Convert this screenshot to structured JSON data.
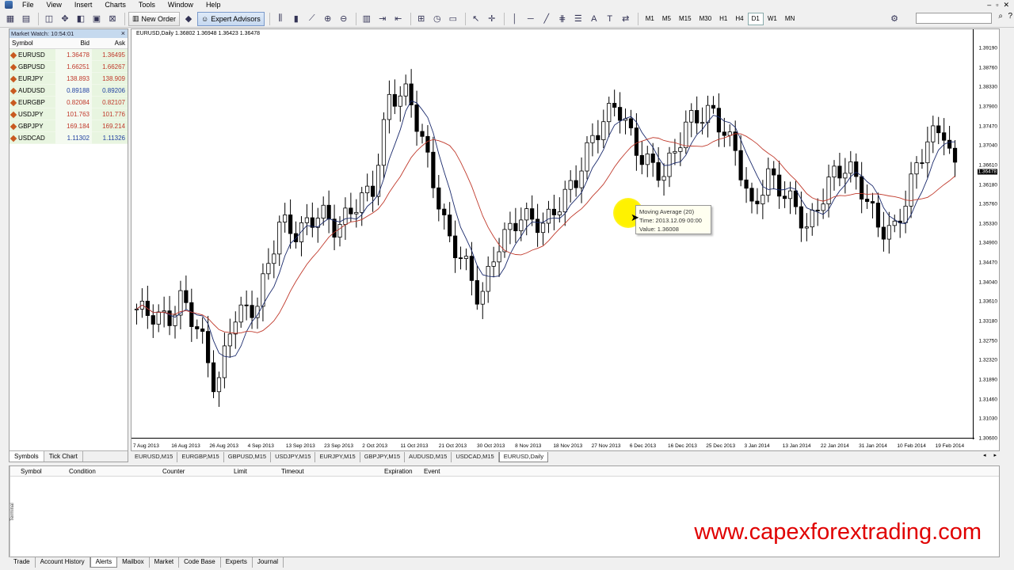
{
  "menu": [
    "File",
    "View",
    "Insert",
    "Charts",
    "Tools",
    "Window",
    "Help"
  ],
  "toolbar": {
    "new_order": "New Order",
    "expert_advisors": "Expert Advisors",
    "timeframes": [
      "M1",
      "M5",
      "M15",
      "M30",
      "H1",
      "H4",
      "D1",
      "W1",
      "MN"
    ],
    "active_timeframe": "D1"
  },
  "market_watch": {
    "title": "Market Watch: 10:54:01",
    "headers": {
      "symbol": "Symbol",
      "bid": "Bid",
      "ask": "Ask"
    },
    "rows": [
      {
        "symbol": "EURUSD",
        "bid": "1.36478",
        "ask": "1.36495",
        "color": "#c0392b"
      },
      {
        "symbol": "GBPUSD",
        "bid": "1.66251",
        "ask": "1.66267",
        "color": "#c0392b"
      },
      {
        "symbol": "EURJPY",
        "bid": "138.893",
        "ask": "138.909",
        "color": "#c0392b"
      },
      {
        "symbol": "AUDUSD",
        "bid": "0.89188",
        "ask": "0.89206",
        "color": "#1f3fa0"
      },
      {
        "symbol": "EURGBP",
        "bid": "0.82084",
        "ask": "0.82107",
        "color": "#c0392b"
      },
      {
        "symbol": "USDJPY",
        "bid": "101.763",
        "ask": "101.776",
        "color": "#c0392b"
      },
      {
        "symbol": "GBPJPY",
        "bid": "169.184",
        "ask": "169.214",
        "color": "#c0392b"
      },
      {
        "symbol": "USDCAD",
        "bid": "1.11302",
        "ask": "1.11326",
        "color": "#1f3fa0"
      }
    ],
    "tabs": [
      "Symbols",
      "Tick Chart"
    ]
  },
  "chart": {
    "label": "EURUSD,Daily  1.36802 1.36948 1.36423 1.36478",
    "price_ticks": [
      "1.39190",
      "1.38760",
      "1.38330",
      "1.37900",
      "1.37470",
      "1.37040",
      "1.36610",
      "1.36478",
      "1.36180",
      "1.35760",
      "1.35330",
      "1.34900",
      "1.34470",
      "1.34040",
      "1.33610",
      "1.33180",
      "1.32750",
      "1.32320",
      "1.31890",
      "1.31460",
      "1.31030",
      "1.30600"
    ],
    "current_price": "1.36478",
    "date_ticks": [
      "7 Aug 2013",
      "16 Aug 2013",
      "26 Aug 2013",
      "4 Sep 2013",
      "13 Sep 2013",
      "23 Sep 2013",
      "2 Oct 2013",
      "11 Oct 2013",
      "21 Oct 2013",
      "30 Oct 2013",
      "8 Nov 2013",
      "18 Nov 2013",
      "27 Nov 2013",
      "6 Dec 2013",
      "16 Dec 2013",
      "25 Dec 2013",
      "3 Jan 2014",
      "13 Jan 2014",
      "22 Jan 2014",
      "31 Jan 2014",
      "10 Feb 2014",
      "19 Feb 2014"
    ],
    "tooltip": {
      "title": "Moving Average (20)",
      "time": "Time: 2013.12.09 00:00",
      "value": "Value: 1.36008"
    },
    "ma_fast_color": "#1a2a6c",
    "ma_slow_color": "#c0392b"
  },
  "chart_tabs": [
    "EURUSD,M15",
    "EURGBP,M15",
    "GBPUSD,M15",
    "USDJPY,M15",
    "EURJPY,M15",
    "GBPJPY,M15",
    "AUDUSD,M15",
    "USDCAD,M15",
    "EURUSD,Daily"
  ],
  "active_chart_tab": "EURUSD,Daily",
  "terminal": {
    "side_label": "Terminal",
    "headers": [
      "Symbol",
      "Condition",
      "Counter",
      "Limit",
      "Timeout",
      "Expiration",
      "Event"
    ],
    "tabs": [
      "Trade",
      "Account History",
      "Alerts",
      "Mailbox",
      "Market",
      "Code Base",
      "Experts",
      "Journal"
    ],
    "active_tab": "Alerts"
  },
  "watermark": "www.capexforextrading.com"
}
